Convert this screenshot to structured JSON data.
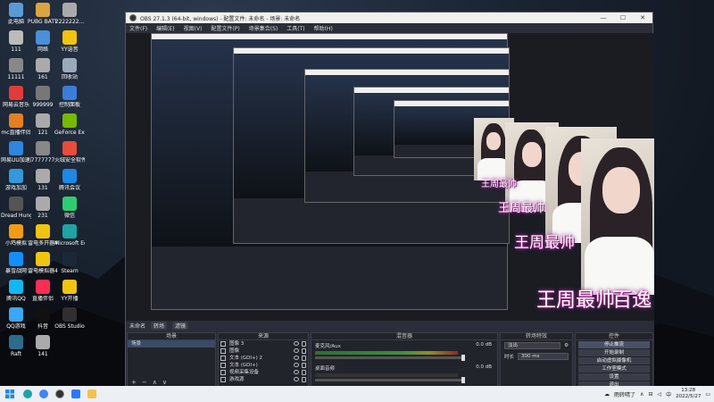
{
  "desktop": {
    "icons": [
      {
        "label": "此电脑",
        "color": "#5b9bd5"
      },
      {
        "label": "PUBG BATTLEGR...",
        "color": "#d9a441"
      },
      {
        "label": "2222222...",
        "color": "#aaa"
      },
      {
        "label": "111",
        "color": "#bbb"
      },
      {
        "label": "网络",
        "color": "#4a8fd8"
      },
      {
        "label": "YY语音",
        "color": "#f1c40f"
      },
      {
        "label": "11111",
        "color": "#888"
      },
      {
        "label": "161",
        "color": "#aaa"
      },
      {
        "label": "回收站",
        "color": "#9ab"
      },
      {
        "label": "网易云音乐",
        "color": "#e23b3b"
      },
      {
        "label": "999999",
        "color": "#777"
      },
      {
        "label": "控制面板",
        "color": "#3c7dd9"
      },
      {
        "label": "mc直播伴侣",
        "color": "#e67e22"
      },
      {
        "label": "121",
        "color": "#aaa"
      },
      {
        "label": "GeForce Experience",
        "color": "#76b900"
      },
      {
        "label": "网易UU加速器",
        "color": "#2e86de"
      },
      {
        "label": "7777777",
        "color": "#888"
      },
      {
        "label": "火绒安全软件",
        "color": "#e74c3c"
      },
      {
        "label": "游戏加加",
        "color": "#3498db"
      },
      {
        "label": "131",
        "color": "#aaa"
      },
      {
        "label": "腾讯会议",
        "color": "#1e88e5"
      },
      {
        "label": "Dread Hunger",
        "color": "#555"
      },
      {
        "label": "231",
        "color": "#aaa"
      },
      {
        "label": "微信",
        "color": "#2ecc71"
      },
      {
        "label": "小鸡模拟",
        "color": "#f39c12"
      },
      {
        "label": "雷电多开器4",
        "color": "#f1c40f"
      },
      {
        "label": "Microsoft Edge",
        "color": "#1fa3a3"
      },
      {
        "label": "暴雪战网",
        "color": "#148eff"
      },
      {
        "label": "雷电模拟器4",
        "color": "#f1c40f"
      },
      {
        "label": "Steam",
        "color": "#1b2838"
      },
      {
        "label": "腾讯QQ",
        "color": "#12b7f5"
      },
      {
        "label": "直播伴侣",
        "color": "#fe2c55"
      },
      {
        "label": "YY开播",
        "color": "#f1c40f"
      },
      {
        "label": "QQ游戏",
        "color": "#3ca7f2"
      },
      {
        "label": "抖音",
        "color": "#111"
      },
      {
        "label": "OBS Studio",
        "color": "#302e31"
      },
      {
        "label": "Raft",
        "color": "#2d6c8a"
      },
      {
        "label": "141",
        "color": "#aaa"
      }
    ]
  },
  "window": {
    "title": "OBS 27.1.3 (64-bit, windows) - 配置文件: 未命名 - 场景: 未命名",
    "controls": {
      "minimize": "—",
      "maximize": "☐",
      "close": "✕"
    }
  },
  "menu": [
    "文件(F)",
    "编辑(E)",
    "视图(V)",
    "配置文件(P)",
    "场景集合(S)",
    "工具(T)",
    "帮助(H)"
  ],
  "overlay": {
    "caption1": "王周最帅",
    "caption2": "百逸"
  },
  "dock_tabs": {
    "label": "未命名",
    "chip1": "转场",
    "chip2": "滤镜"
  },
  "scenes": {
    "header": "场景",
    "items": [
      "场景"
    ]
  },
  "sources": {
    "header": "来源",
    "items": [
      "图像 3",
      "图像",
      "文本 (GDI+) 2",
      "文本 (GDI+)",
      "视频采集设备",
      "游戏源"
    ]
  },
  "mixer": {
    "header": "混音器",
    "channels": [
      {
        "name": "麦克风/Aux",
        "db": "0.0 dB"
      },
      {
        "name": "桌面音频",
        "db": "0.0 dB"
      }
    ]
  },
  "transitions": {
    "header": "转场特效",
    "type": "淡出",
    "duration_label": "时长",
    "duration_value": "300 ms"
  },
  "controls": {
    "header": "控件",
    "buttons": [
      "停止推流",
      "开始录制",
      "启动虚拟摄像机",
      "工作室模式",
      "设置",
      "退出"
    ]
  },
  "taskbar": {
    "tray_text": "雨转晴了",
    "ime": "中",
    "time": "13:28",
    "date": "2022/5/27"
  },
  "colors": {
    "obs_panel": "#2b2e38",
    "overlay_glow": "#c22a8a",
    "meter_green": "#3d8f3d"
  }
}
